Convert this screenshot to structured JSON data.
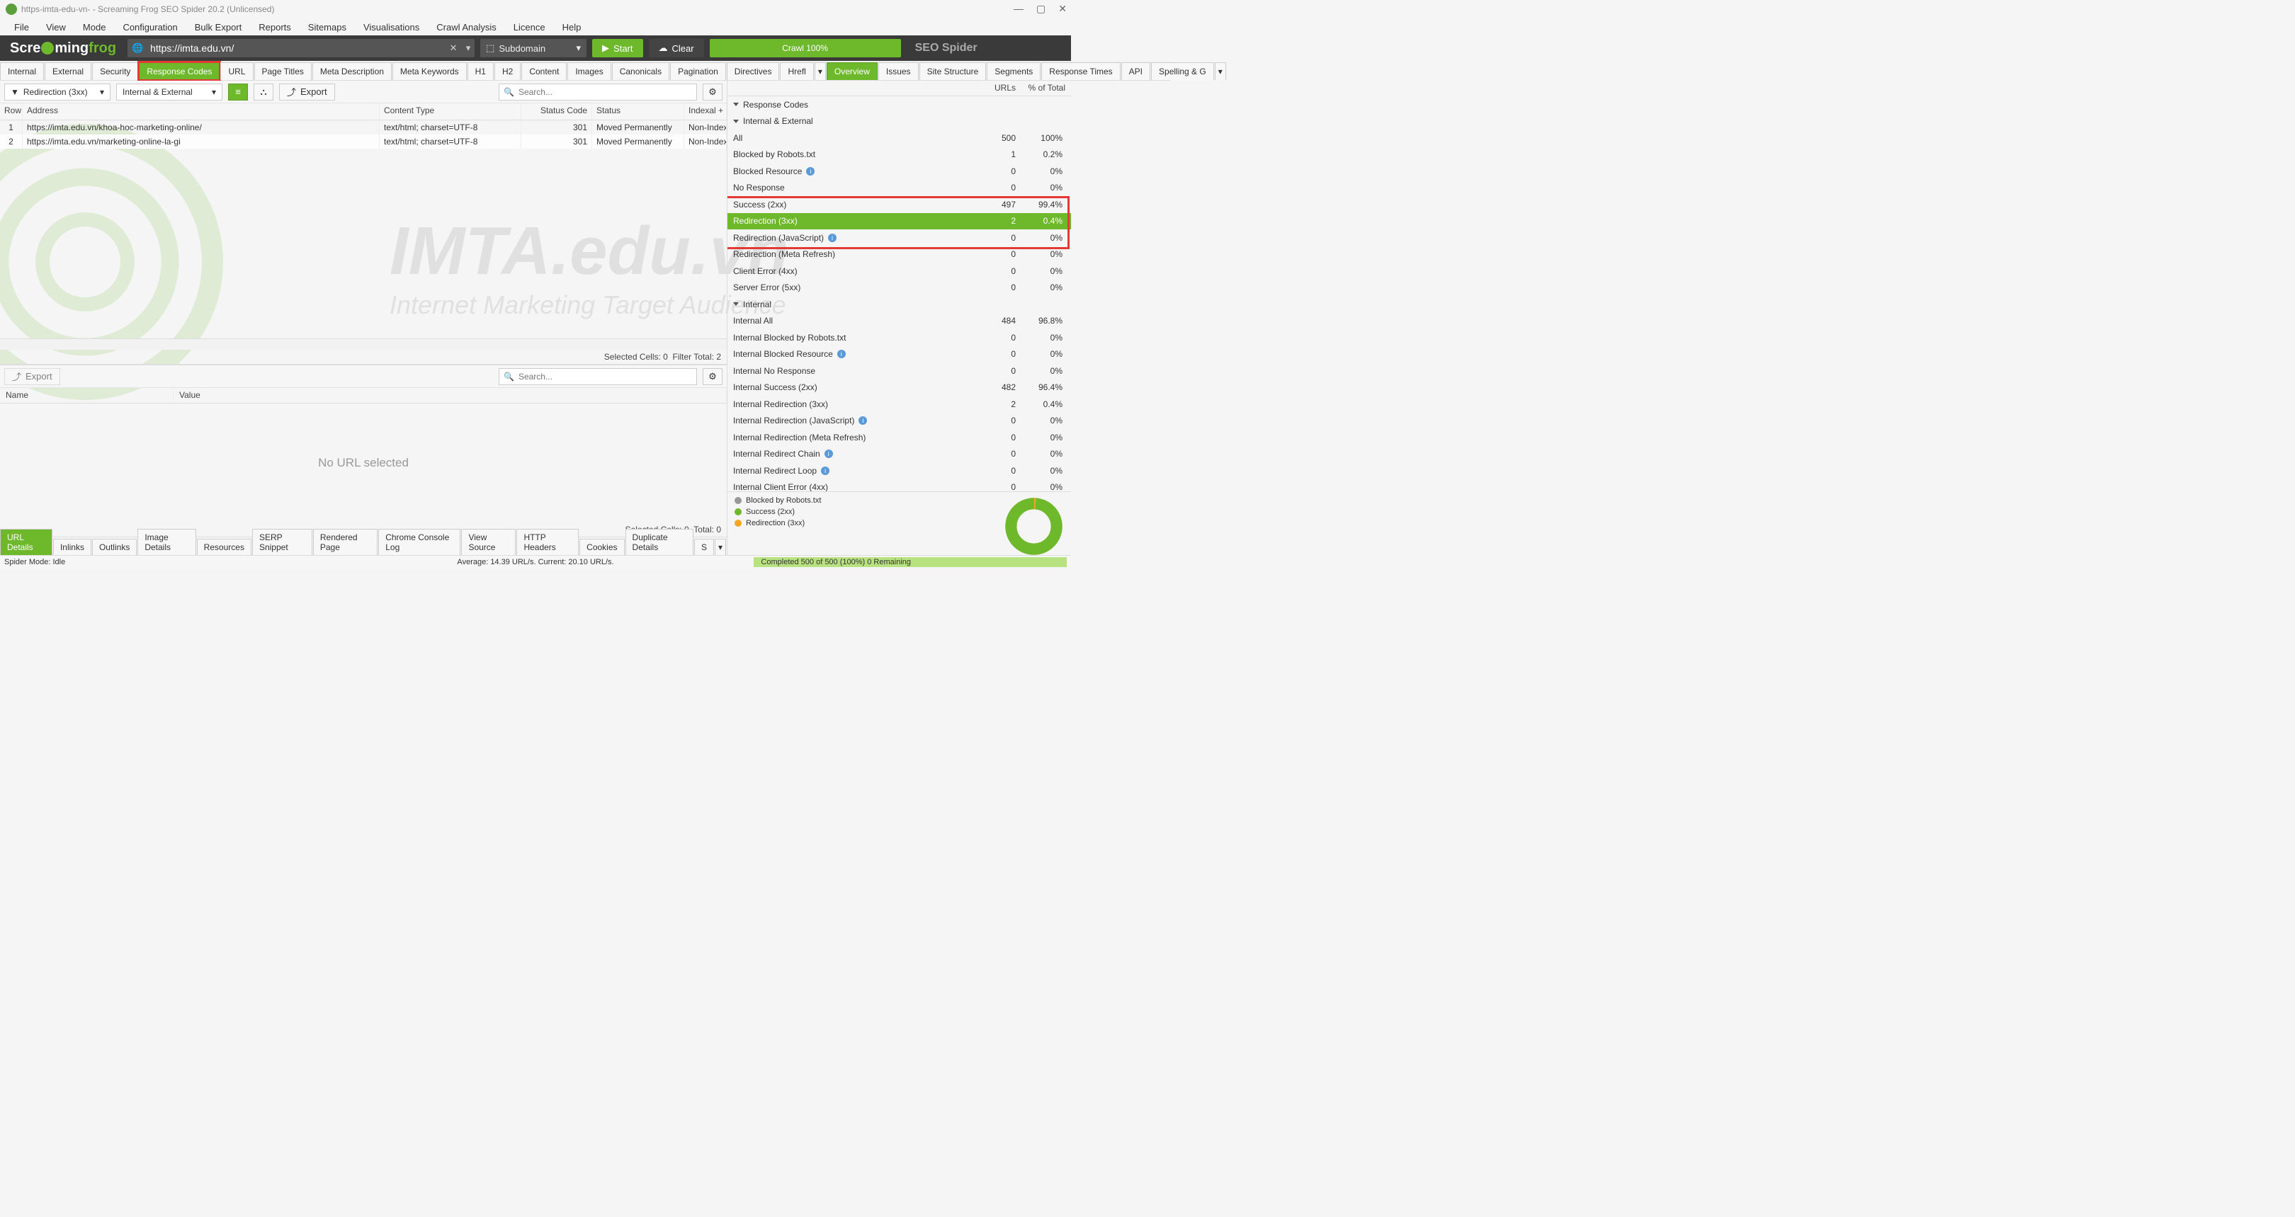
{
  "title": "https-imta-edu-vn- - Screaming Frog SEO Spider 20.2 (Unlicensed)",
  "menubar": [
    "File",
    "View",
    "Mode",
    "Configuration",
    "Bulk Export",
    "Reports",
    "Sitemaps",
    "Visualisations",
    "Crawl Analysis",
    "Licence",
    "Help"
  ],
  "logo": {
    "a": "Scre",
    "b": "a",
    "c": "ming",
    "d": "frog"
  },
  "url": "https://imta.edu.vn/",
  "crawl_scope": "Subdomain",
  "btn_start": "Start",
  "btn_clear": "Clear",
  "crawl_progress": "Crawl 100%",
  "seo_spider": "SEO Spider",
  "maintabs": [
    "Internal",
    "External",
    "Security",
    "Response Codes",
    "URL",
    "Page Titles",
    "Meta Description",
    "Meta Keywords",
    "H1",
    "H2",
    "Content",
    "Images",
    "Canonicals",
    "Pagination",
    "Directives",
    "Hrefl"
  ],
  "maintab_active": 3,
  "filter1": "Redirection (3xx)",
  "filter2": "Internal & External",
  "export_label": "Export",
  "search_placeholder": "Search...",
  "grid": {
    "cols": [
      "Row",
      "Address",
      "Content Type",
      "Status Code",
      "Status",
      "Indexal"
    ],
    "rows": [
      {
        "row": "1",
        "addr": "https://imta.edu.vn/khoa-hoc-marketing-online/",
        "ct": "text/html; charset=UTF-8",
        "sc": "301",
        "st": "Moved Permanently",
        "idx": "Non-Index"
      },
      {
        "row": "2",
        "addr": "https://imta.edu.vn/marketing-online-la-gi",
        "ct": "text/html; charset=UTF-8",
        "sc": "301",
        "st": "Moved Permanently",
        "idx": "Non-Index"
      }
    ]
  },
  "sel_cells": "Selected Cells: 0",
  "filter_total": "Filter Total: 2",
  "kv_cols": {
    "name": "Name",
    "value": "Value"
  },
  "no_url": "No URL selected",
  "sel_cells2": "Selected Cells: 0",
  "total2": "Total: 0",
  "lowertabs": [
    "URL Details",
    "Inlinks",
    "Outlinks",
    "Image Details",
    "Resources",
    "SERP Snippet",
    "Rendered Page",
    "Chrome Console Log",
    "View Source",
    "HTTP Headers",
    "Cookies",
    "Duplicate Details",
    "S"
  ],
  "righttabs": [
    "Overview",
    "Issues",
    "Site Structure",
    "Segments",
    "Response Times",
    "API",
    "Spelling & G"
  ],
  "righttab_active": 0,
  "right_head": {
    "urls": "URLs",
    "pct": "% of Total"
  },
  "tree": [
    {
      "ind": 0,
      "name": "Response Codes",
      "caret": true
    },
    {
      "ind": 1,
      "name": "Internal & External",
      "caret": true
    },
    {
      "ind": 2,
      "name": "All",
      "u": "500",
      "p": "100%"
    },
    {
      "ind": 2,
      "name": "Blocked by Robots.txt",
      "u": "1",
      "p": "0.2%"
    },
    {
      "ind": 2,
      "name": "Blocked Resource",
      "info": true,
      "u": "0",
      "p": "0%"
    },
    {
      "ind": 2,
      "name": "No Response",
      "u": "0",
      "p": "0%"
    },
    {
      "ind": 2,
      "name": "Success (2xx)",
      "u": "497",
      "p": "99.4%"
    },
    {
      "ind": 2,
      "name": "Redirection (3xx)",
      "u": "2",
      "p": "0.4%",
      "sel": true
    },
    {
      "ind": 2,
      "name": "Redirection (JavaScript)",
      "info": true,
      "u": "0",
      "p": "0%"
    },
    {
      "ind": 2,
      "name": "Redirection (Meta Refresh)",
      "u": "0",
      "p": "0%"
    },
    {
      "ind": 2,
      "name": "Client Error (4xx)",
      "u": "0",
      "p": "0%"
    },
    {
      "ind": 2,
      "name": "Server Error (5xx)",
      "u": "0",
      "p": "0%"
    },
    {
      "ind": 1,
      "name": "Internal",
      "caret": true
    },
    {
      "ind": 2,
      "name": "Internal All",
      "u": "484",
      "p": "96.8%"
    },
    {
      "ind": 2,
      "name": "Internal Blocked by Robots.txt",
      "u": "0",
      "p": "0%"
    },
    {
      "ind": 2,
      "name": "Internal Blocked Resource",
      "info": true,
      "u": "0",
      "p": "0%"
    },
    {
      "ind": 2,
      "name": "Internal No Response",
      "u": "0",
      "p": "0%"
    },
    {
      "ind": 2,
      "name": "Internal Success (2xx)",
      "u": "482",
      "p": "96.4%"
    },
    {
      "ind": 2,
      "name": "Internal Redirection (3xx)",
      "u": "2",
      "p": "0.4%"
    },
    {
      "ind": 2,
      "name": "Internal Redirection (JavaScript)",
      "info": true,
      "u": "0",
      "p": "0%"
    },
    {
      "ind": 2,
      "name": "Internal Redirection (Meta Refresh)",
      "u": "0",
      "p": "0%"
    },
    {
      "ind": 2,
      "name": "Internal Redirect Chain",
      "info": true,
      "u": "0",
      "p": "0%"
    },
    {
      "ind": 2,
      "name": "Internal Redirect Loop",
      "info": true,
      "u": "0",
      "p": "0%"
    },
    {
      "ind": 2,
      "name": "Internal Client Error (4xx)",
      "u": "0",
      "p": "0%"
    }
  ],
  "legend": [
    {
      "color": "#999",
      "label": "Blocked by Robots.txt"
    },
    {
      "color": "#6eb82b",
      "label": "Success (2xx)"
    },
    {
      "color": "#f5a623",
      "label": "Redirection (3xx)"
    }
  ],
  "status": {
    "mode": "Spider Mode: Idle",
    "center": "Average: 14.39 URL/s. Current: 20.10 URL/s.",
    "right": "Completed 500 of 500 (100%) 0 Remaining"
  },
  "wm1": "IMTA.edu.vn",
  "wm2": "Internet Marketing Target Audience",
  "chart_data": {
    "type": "pie",
    "title": "Response Codes",
    "series": [
      {
        "name": "Blocked by Robots.txt",
        "value": 1,
        "color": "#999"
      },
      {
        "name": "Success (2xx)",
        "value": 497,
        "color": "#6eb82b"
      },
      {
        "name": "Redirection (3xx)",
        "value": 2,
        "color": "#f5a623"
      }
    ]
  }
}
